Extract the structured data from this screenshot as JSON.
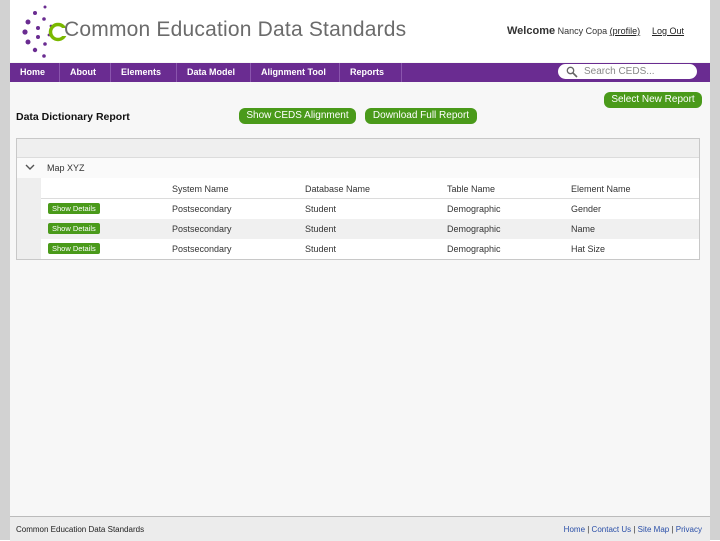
{
  "header": {
    "logo_text": "Common Education Data Standards",
    "welcome_label": "Welcome",
    "user_name": "Nancy Copa",
    "profile_link": "(profile)",
    "logout_link": "Log Out"
  },
  "nav": {
    "items": [
      {
        "label": "Home"
      },
      {
        "label": "About"
      },
      {
        "label": "Elements"
      },
      {
        "label": "Data Model"
      },
      {
        "label": "Alignment Tool"
      },
      {
        "label": "Reports"
      }
    ],
    "search_placeholder": "Search CEDS..."
  },
  "report": {
    "title": "Data Dictionary Report",
    "show_alignment_label": "Show CEDS Alignment",
    "download_label": "Download Full Report",
    "select_new_label": "Select New Report",
    "group_label": "Map XYZ",
    "columns": [
      "System Name",
      "Database Name",
      "Table Name",
      "Element Name"
    ],
    "show_details_label": "Show Details",
    "rows": [
      [
        "Postsecondary",
        "Student",
        "Demographic",
        "Gender"
      ],
      [
        "Postsecondary",
        "Student",
        "Demographic",
        "Name"
      ],
      [
        "Postsecondary",
        "Student",
        "Demographic",
        "Hat Size"
      ]
    ]
  },
  "footer": {
    "left_text": "Common Education Data Standards",
    "links": [
      "Home",
      "Contact Us",
      "Site Map",
      "Privacy"
    ],
    "separator": " | "
  },
  "colors": {
    "brand_purple": "#6a2c91",
    "button_green": "#4a9a1a"
  }
}
